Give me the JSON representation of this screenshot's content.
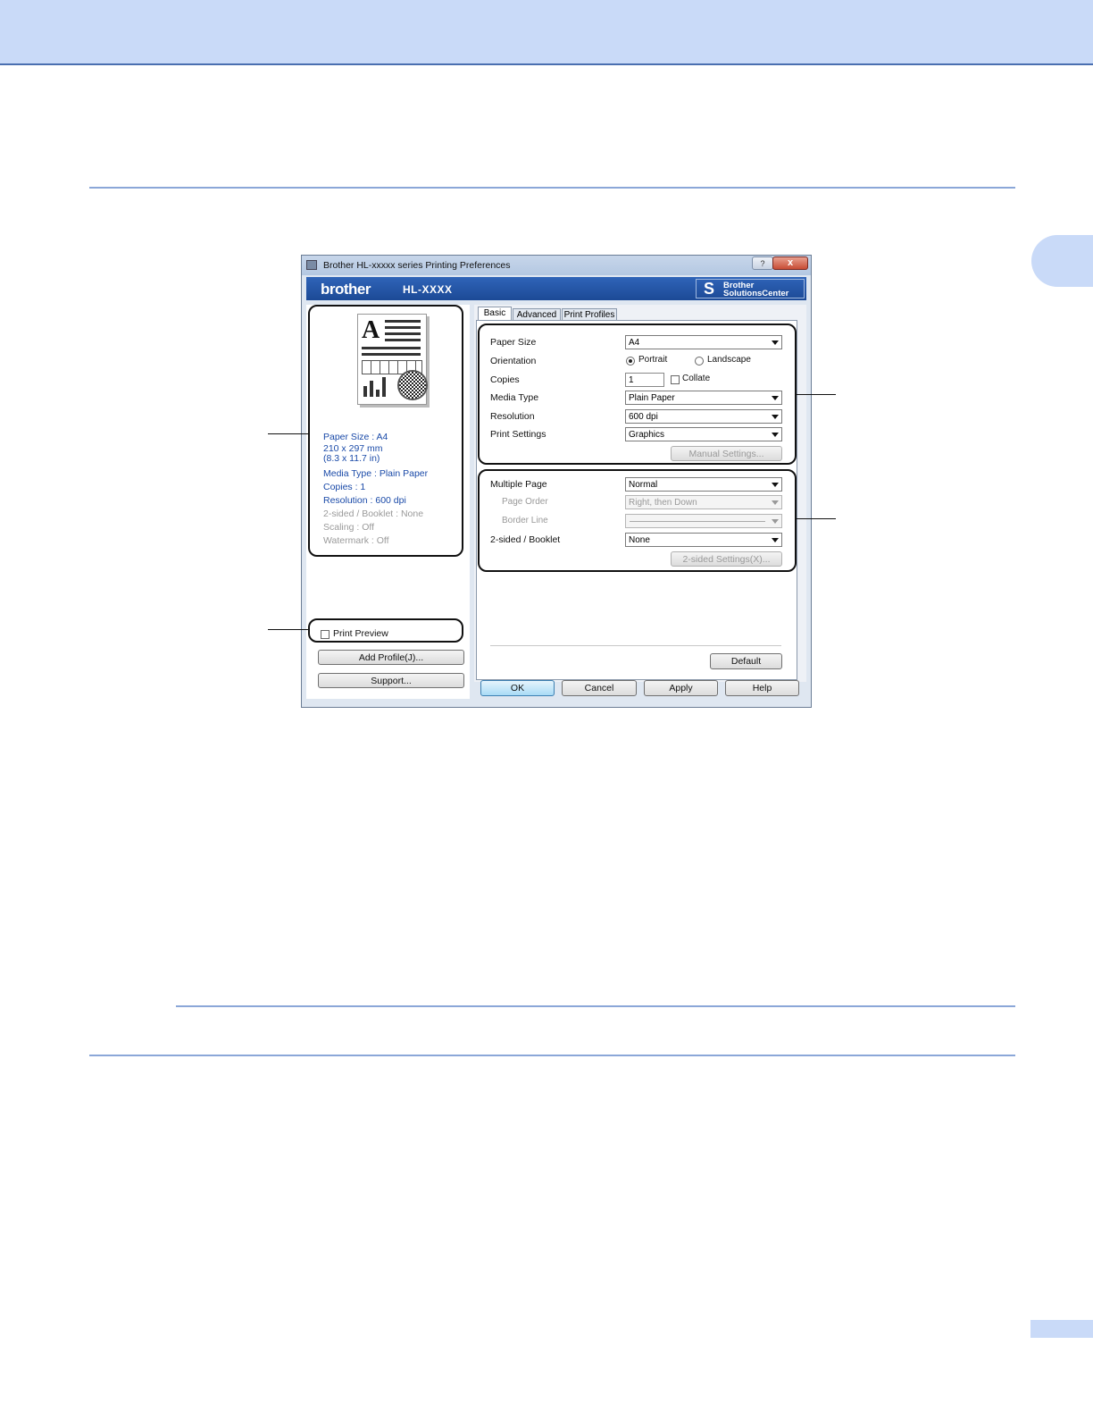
{
  "dialog": {
    "title": "Brother HL-xxxxx series Printing Preferences",
    "help_label": "?",
    "close_label": "x",
    "brand": "brother",
    "model": "HL-XXXX",
    "solutions_line1": "Brother",
    "solutions_line2": "SolutionsCenter",
    "solutions_icon": "S"
  },
  "summary": {
    "paper_size": "Paper Size : A4",
    "dim_mm": "210 x 297 mm",
    "dim_in": "(8.3 x 11.7 in)",
    "media_type": "Media Type : Plain Paper",
    "copies": "Copies : 1",
    "resolution": "Resolution : 600 dpi",
    "duplex": "2-sided / Booklet : None",
    "scaling": "Scaling : Off",
    "watermark": "Watermark : Off"
  },
  "preview_letter": "A",
  "print_preview_label": "Print Preview",
  "left_buttons": {
    "add_profile": "Add Profile(J)...",
    "support": "Support..."
  },
  "tabs": [
    "Basic",
    "Advanced",
    "Print Profiles"
  ],
  "basic": {
    "paper_size_label": "Paper Size",
    "paper_size_value": "A4",
    "orientation_label": "Orientation",
    "portrait_label": "Portrait",
    "landscape_label": "Landscape",
    "copies_label": "Copies",
    "copies_value": "1",
    "collate_label": "Collate",
    "media_type_label": "Media Type",
    "media_type_value": "Plain Paper",
    "resolution_label": "Resolution",
    "resolution_value": "600 dpi",
    "print_settings_label": "Print Settings",
    "print_settings_value": "Graphics",
    "manual_settings_button": "Manual Settings...",
    "multiple_page_label": "Multiple Page",
    "multiple_page_value": "Normal",
    "page_order_label": "Page Order",
    "page_order_value": "Right, then Down",
    "border_line_label": "Border Line",
    "duplex_label": "2-sided / Booklet",
    "duplex_value": "None",
    "duplex_settings_button": "2-sided Settings(X)...",
    "default_button": "Default"
  },
  "bottom_buttons": {
    "ok": "OK",
    "cancel": "Cancel",
    "apply": "Apply",
    "help": "Help"
  },
  "colors": {
    "page_accent": "#c9daf8",
    "brand_bar": "#1c4a96",
    "summary_text": "#1a4aa8"
  }
}
